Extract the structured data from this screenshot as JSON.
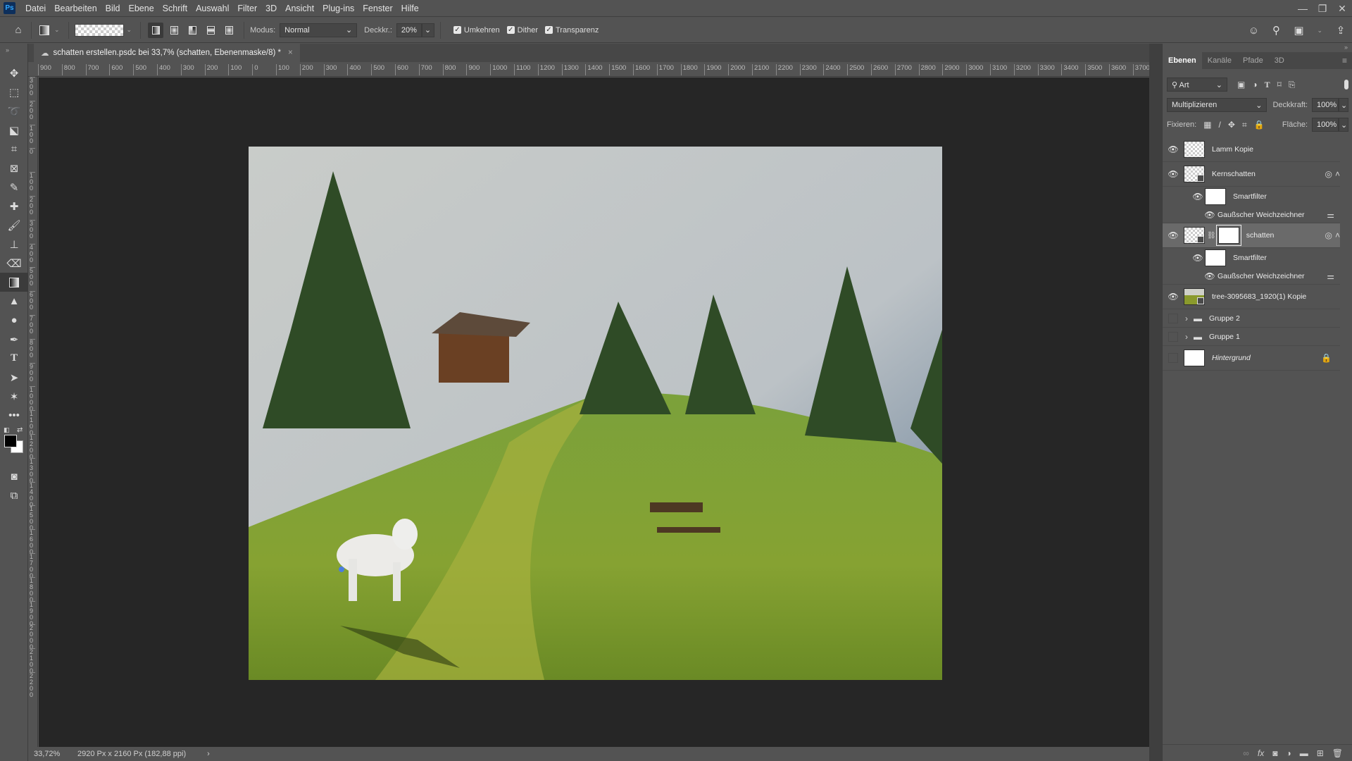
{
  "menubar": {
    "app_icon": "Ps",
    "items": [
      "Datei",
      "Bearbeiten",
      "Bild",
      "Ebene",
      "Schrift",
      "Auswahl",
      "Filter",
      "3D",
      "Ansicht",
      "Plug-ins",
      "Fenster",
      "Hilfe"
    ],
    "window_controls": {
      "minimize": "—",
      "restore": "❐",
      "close": "✕"
    }
  },
  "options": {
    "modus_label": "Modus:",
    "modus_value": "Normal",
    "deckkraft_label": "Deckkr.:",
    "deckkraft_value": "20%",
    "checks": [
      {
        "label": "Umkehren",
        "checked": true
      },
      {
        "label": "Dither",
        "checked": true
      },
      {
        "label": "Transparenz",
        "checked": true
      }
    ]
  },
  "document": {
    "tab_title": "schatten erstellen.psdc bei 33,7% (schatten, Ebenenmaske/8) *",
    "close": "×"
  },
  "ruler": {
    "h_ticks": [
      "900",
      "800",
      "700",
      "600",
      "500",
      "400",
      "300",
      "200",
      "100",
      "0",
      "100",
      "200",
      "300",
      "400",
      "500",
      "600",
      "700",
      "800",
      "900",
      "1000",
      "1100",
      "1200",
      "1300",
      "1400",
      "1500",
      "1600",
      "1700",
      "1800",
      "1900",
      "2000",
      "2100",
      "2200",
      "2300",
      "2400",
      "2500",
      "2600",
      "2700",
      "2800",
      "2900",
      "3000",
      "3100",
      "3200",
      "3300",
      "3400",
      "3500",
      "3600",
      "3700"
    ],
    "v_ticks": [
      "300",
      "200",
      "100",
      "0",
      "100",
      "200",
      "300",
      "400",
      "500",
      "600",
      "700",
      "800",
      "900",
      "1000",
      "1100",
      "1200",
      "1300",
      "1400",
      "1500",
      "1600",
      "1700",
      "1800",
      "1900",
      "2000",
      "2100",
      "2200"
    ]
  },
  "status": {
    "zoom": "33,72%",
    "doc_info": "2920 Px x 2160 Px (182,88 ppi)",
    "arrow": "›"
  },
  "layers_panel": {
    "tabs": [
      "Ebenen",
      "Kanäle",
      "Pfade",
      "3D"
    ],
    "active_tab": "Ebenen",
    "filter_label": "Art",
    "blend_mode": "Multiplizieren",
    "opacity_label": "Deckkraft:",
    "opacity_value": "100%",
    "lock_label": "Fixieren:",
    "fill_label": "Fläche:",
    "fill_value": "100%",
    "layers": [
      {
        "name": "Lamm Kopie",
        "visible": true,
        "type": "pixel"
      },
      {
        "name": "Kernschatten",
        "visible": true,
        "type": "smart"
      },
      {
        "name": "Smartfilter",
        "visible": true,
        "type": "smartfilter"
      },
      {
        "name": "Gaußscher Weichzeichner",
        "visible": true,
        "type": "filter"
      },
      {
        "name": "schatten",
        "visible": true,
        "type": "smart-mask",
        "selected": true
      },
      {
        "name": "Smartfilter",
        "visible": true,
        "type": "smartfilter"
      },
      {
        "name": "Gaußscher Weichzeichner",
        "visible": true,
        "type": "filter"
      },
      {
        "name": "tree-3095683_1920(1) Kopie",
        "visible": true,
        "type": "smart-photo"
      },
      {
        "name": "Gruppe 2",
        "visible": false,
        "type": "group"
      },
      {
        "name": "Gruppe 1",
        "visible": false,
        "type": "group"
      },
      {
        "name": "Hintergrund",
        "visible": false,
        "type": "background",
        "locked": true
      }
    ]
  },
  "colors": {
    "foreground": "#000000",
    "background": "#ffffff"
  }
}
